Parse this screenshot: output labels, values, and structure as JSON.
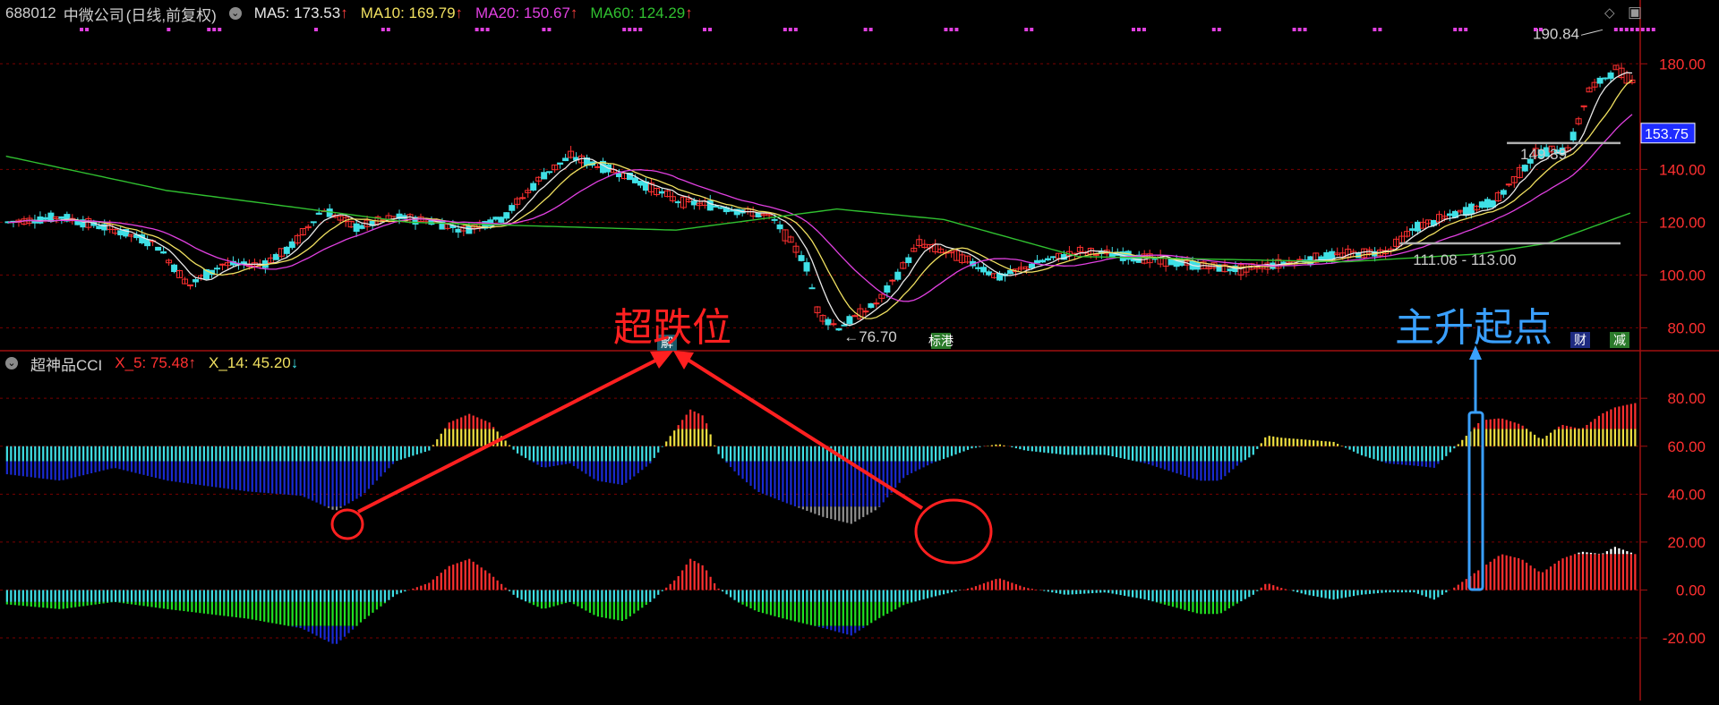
{
  "header": {
    "symbol": "688012",
    "name": "中微公司",
    "period": "(日线,前复权)",
    "ma5": "MA5: 173.53",
    "ma10": "MA10: 169.79",
    "ma20": "MA20: 150.67",
    "ma60": "MA60: 124.29",
    "arrow_up": "↑"
  },
  "sub_header": {
    "name": "超神品CCI",
    "x5": "X_5: 75.48",
    "x14": "X_14: 45.20",
    "arrow_down": "↓"
  },
  "annotations": {
    "oversold": "超跌位",
    "start_point": "主升起点"
  },
  "badges": {
    "jie": "解",
    "biaogang": "标港",
    "cai": "财",
    "jian": "减"
  },
  "colors": {
    "bg": "#000000",
    "grid": "#7a0000",
    "axis": "#a01010",
    "up": "#ff3030",
    "down": "#3fe0e6",
    "ma5": "#e8e8e8",
    "ma10": "#f0e060",
    "ma20": "#e040e0",
    "ma60": "#30c030",
    "ann_red": "#ff2020",
    "ann_blue": "#3aa0ff"
  },
  "chart_data": [
    {
      "type": "candlestick",
      "ylim": [
        72,
        194
      ],
      "y_ticks": [
        "180.00",
        "140.00",
        "120.00",
        "100.00",
        "80.00"
      ],
      "y_tick_values": [
        180,
        140,
        120,
        100,
        80
      ],
      "last_price": "153.75",
      "last_price_value": 153.75,
      "level_line_label": "149.39",
      "level_line_value": 150,
      "range_label": "111.08 - 113.00",
      "range_value": 112,
      "high_label": "190.84",
      "high_value": 190.84,
      "low_label": "76.70",
      "low_value": 76.7,
      "close_keyframes": [
        [
          0,
          120
        ],
        [
          40,
          122
        ],
        [
          80,
          117
        ],
        [
          110,
          112
        ],
        [
          135,
          96
        ],
        [
          160,
          104
        ],
        [
          190,
          104
        ],
        [
          210,
          110
        ],
        [
          235,
          125
        ],
        [
          260,
          118
        ],
        [
          290,
          122
        ],
        [
          320,
          120
        ],
        [
          340,
          117
        ],
        [
          370,
          122
        ],
        [
          400,
          138
        ],
        [
          420,
          145
        ],
        [
          460,
          138
        ],
        [
          500,
          128
        ],
        [
          530,
          126
        ],
        [
          570,
          122
        ],
        [
          595,
          105
        ],
        [
          605,
          85
        ],
        [
          620,
          80
        ],
        [
          650,
          90
        ],
        [
          680,
          112
        ],
        [
          710,
          107
        ],
        [
          740,
          99
        ],
        [
          770,
          105
        ],
        [
          800,
          109
        ],
        [
          840,
          107
        ],
        [
          880,
          104
        ],
        [
          920,
          102
        ],
        [
          970,
          106
        ],
        [
          1000,
          108
        ],
        [
          1030,
          109
        ],
        [
          1050,
          118
        ],
        [
          1080,
          123
        ],
        [
          1110,
          128
        ],
        [
          1140,
          146
        ],
        [
          1165,
          148
        ],
        [
          1180,
          170
        ],
        [
          1200,
          178
        ],
        [
          1215,
          172
        ]
      ],
      "ma60_keyframes": [
        [
          0,
          145
        ],
        [
          120,
          132
        ],
        [
          300,
          120
        ],
        [
          500,
          117
        ],
        [
          620,
          125
        ],
        [
          700,
          121
        ],
        [
          800,
          107
        ],
        [
          1000,
          105
        ],
        [
          1100,
          108
        ],
        [
          1150,
          112
        ],
        [
          1215,
          124
        ]
      ]
    },
    {
      "type": "bar",
      "name": "超神品CCI",
      "ylim": [
        -45,
        95
      ],
      "y_ticks": [
        "80.00",
        "60.00",
        "40.00",
        "20.00",
        "0.00",
        "-20.00"
      ],
      "y_tick_values": [
        80,
        60,
        40,
        20,
        0,
        -20
      ],
      "x5_keyframes": [
        [
          0,
          -6
        ],
        [
          40,
          -8
        ],
        [
          80,
          -5
        ],
        [
          120,
          -8
        ],
        [
          180,
          -12
        ],
        [
          220,
          -16
        ],
        [
          245,
          -23
        ],
        [
          265,
          -13
        ],
        [
          290,
          -2
        ],
        [
          315,
          3
        ],
        [
          330,
          10
        ],
        [
          345,
          13
        ],
        [
          360,
          7
        ],
        [
          380,
          -3
        ],
        [
          400,
          -8
        ],
        [
          420,
          -5
        ],
        [
          440,
          -11
        ],
        [
          460,
          -13
        ],
        [
          480,
          -5
        ],
        [
          500,
          5
        ],
        [
          510,
          13
        ],
        [
          520,
          10
        ],
        [
          530,
          1
        ],
        [
          545,
          -5
        ],
        [
          560,
          -9
        ],
        [
          580,
          -12
        ],
        [
          610,
          -16
        ],
        [
          630,
          -19
        ],
        [
          650,
          -12
        ],
        [
          670,
          -6
        ],
        [
          690,
          -3
        ],
        [
          720,
          1
        ],
        [
          740,
          5
        ],
        [
          760,
          1
        ],
        [
          790,
          -2
        ],
        [
          820,
          -1
        ],
        [
          850,
          -4
        ],
        [
          870,
          -7
        ],
        [
          890,
          -10
        ],
        [
          905,
          -10
        ],
        [
          920,
          -5
        ],
        [
          930,
          -2
        ],
        [
          940,
          3
        ],
        [
          950,
          1
        ],
        [
          970,
          -2
        ],
        [
          990,
          -4
        ],
        [
          1010,
          -2
        ],
        [
          1030,
          -1
        ],
        [
          1050,
          -1
        ],
        [
          1065,
          -4
        ],
        [
          1080,
          1
        ],
        [
          1100,
          9
        ],
        [
          1115,
          15
        ],
        [
          1130,
          13
        ],
        [
          1145,
          7
        ],
        [
          1160,
          13
        ],
        [
          1175,
          16
        ],
        [
          1190,
          15
        ],
        [
          1200,
          18
        ],
        [
          1215,
          15
        ]
      ],
      "x14_keyframes": [
        [
          0,
          -13
        ],
        [
          40,
          -16
        ],
        [
          80,
          -10
        ],
        [
          120,
          -16
        ],
        [
          180,
          -21
        ],
        [
          220,
          -23
        ],
        [
          245,
          -30
        ],
        [
          265,
          -23
        ],
        [
          290,
          -7
        ],
        [
          315,
          -2
        ],
        [
          330,
          11
        ],
        [
          345,
          15
        ],
        [
          360,
          11
        ],
        [
          380,
          -3
        ],
        [
          400,
          -10
        ],
        [
          420,
          -8
        ],
        [
          440,
          -16
        ],
        [
          460,
          -18
        ],
        [
          480,
          -8
        ],
        [
          500,
          9
        ],
        [
          510,
          17
        ],
        [
          520,
          14
        ],
        [
          530,
          -3
        ],
        [
          545,
          -13
        ],
        [
          560,
          -21
        ],
        [
          580,
          -26
        ],
        [
          610,
          -33
        ],
        [
          630,
          -36
        ],
        [
          650,
          -29
        ],
        [
          670,
          -14
        ],
        [
          690,
          -8
        ],
        [
          720,
          -1
        ],
        [
          740,
          1
        ],
        [
          760,
          -2
        ],
        [
          790,
          -4
        ],
        [
          820,
          -4
        ],
        [
          850,
          -8
        ],
        [
          870,
          -12
        ],
        [
          890,
          -16
        ],
        [
          905,
          -16
        ],
        [
          920,
          -8
        ],
        [
          930,
          -4
        ],
        [
          940,
          5
        ],
        [
          950,
          4
        ],
        [
          970,
          3
        ],
        [
          990,
          2
        ],
        [
          1010,
          -4
        ],
        [
          1030,
          -8
        ],
        [
          1050,
          -9
        ],
        [
          1065,
          -10
        ],
        [
          1080,
          -1
        ],
        [
          1100,
          12
        ],
        [
          1115,
          13
        ],
        [
          1130,
          10
        ],
        [
          1145,
          3
        ],
        [
          1160,
          10
        ],
        [
          1175,
          8
        ],
        [
          1190,
          15
        ],
        [
          1200,
          18
        ],
        [
          1215,
          20
        ]
      ]
    }
  ]
}
